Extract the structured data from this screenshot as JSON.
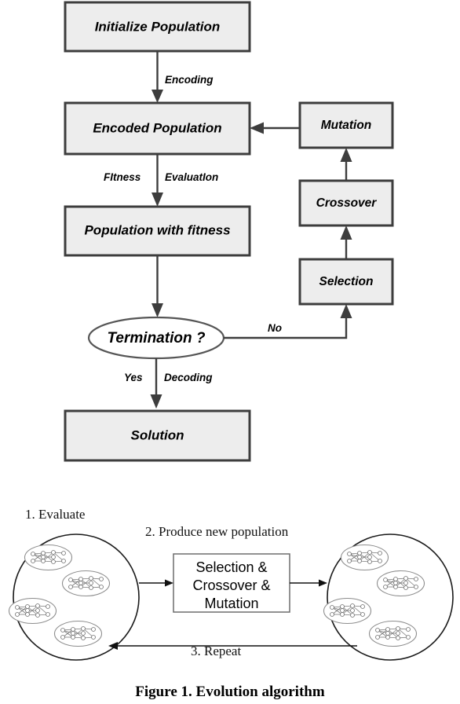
{
  "figure": {
    "caption": "Figure 1. Evolution algorithm"
  },
  "flowchart": {
    "nodes": {
      "initialize": "Initialize Population",
      "encoded": "Encoded Population",
      "population_fitness": "Population with fitness",
      "termination": "Termination ?",
      "solution": "Solution",
      "mutation": "Mutation",
      "crossover": "Crossover",
      "selection": "Selection"
    },
    "edge_labels": {
      "encoding": "Encoding",
      "fitness": "FItness",
      "evaluation": "EvaluatIon",
      "yes": "Yes",
      "decoding": "Decoding",
      "no": "No"
    },
    "colors": {
      "box_fill": "#ededed",
      "box_border": "#3d3d3d",
      "line": "#3d3d3d"
    }
  },
  "cycle_diagram": {
    "steps": {
      "step1": "1. Evaluate",
      "step2": "2. Produce new population",
      "step3": "3. Repeat"
    },
    "operator_box": {
      "line1": "Selection &",
      "line2": "Crossover &",
      "line3": "Mutation"
    },
    "populations": {
      "left_individual_count": 4,
      "right_individual_count": 4
    },
    "colors": {
      "circle_stroke": "#1a1a1a",
      "individual_stroke": "#8d8d8d",
      "network_stroke": "#7a7a7a"
    }
  }
}
